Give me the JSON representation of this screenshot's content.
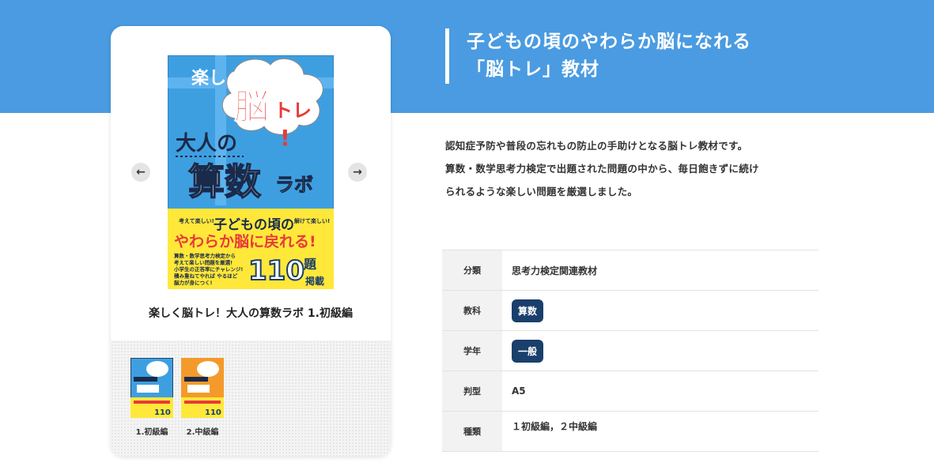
{
  "header": {
    "title_line1": "子どもの頃のやわらか脳になれる",
    "title_line2": "「脳トレ」教材"
  },
  "product": {
    "title": "楽しく脳トレ！大人の算数ラボ 1.初級編",
    "cover": {
      "top_text": "楽しく",
      "bubble_text": "脳",
      "bubble_text2": "トレ",
      "bubble_mark": "!",
      "title_small": "大人の",
      "title_big": "算数",
      "title_side": "ラボ",
      "band_left": "考えて楽しい!",
      "band_right": "解けて楽しい!",
      "band_line1": "子どもの頃の",
      "band_line2": "やわらか脳に戻れる!",
      "blurb_lines": [
        "算数・数学思考力検定から",
        "考えて楽しい問題を厳選!",
        "小学生の正答率にチャレンジ!",
        "積み重ねてやれば やるほど",
        "脳力が身につく!"
      ],
      "count": "110",
      "count_unit": "題",
      "count_label": "掲載"
    },
    "colors": {
      "cover_blue": "#3e9fe0",
      "cover_yellow": "#ffe83a",
      "cover_orange": "#f39a2b",
      "accent_red": "#e83a3a",
      "navy": "#1a3f6b"
    }
  },
  "carousel": {
    "prev_icon": "arrow-left-icon",
    "next_icon": "arrow-right-icon",
    "prev_glyph": "←",
    "next_glyph": "→"
  },
  "thumbnails": [
    {
      "label": "1.初級編",
      "color": "#3e9fe0",
      "count": "110"
    },
    {
      "label": "2.中級編",
      "color": "#f39a2b",
      "count": "110"
    }
  ],
  "description": {
    "lines": [
      "認知症予防や普段の忘れもの防止の手助けとなる脳トレ教材です。",
      "算数・数学思考力検定で出題された問題の中から、毎日飽きずに続け",
      "られるような楽しい問題を厳選しました。"
    ]
  },
  "spec": [
    {
      "key": "分類",
      "value": "思考力検定関連教材",
      "type": "text"
    },
    {
      "key": "教科",
      "value": "算数",
      "type": "tag"
    },
    {
      "key": "学年",
      "value": "一般",
      "type": "tag"
    },
    {
      "key": "判型",
      "value": "A5",
      "type": "text"
    },
    {
      "key": "種類",
      "value": "１初級編，２中級編",
      "type": "text-top"
    }
  ]
}
